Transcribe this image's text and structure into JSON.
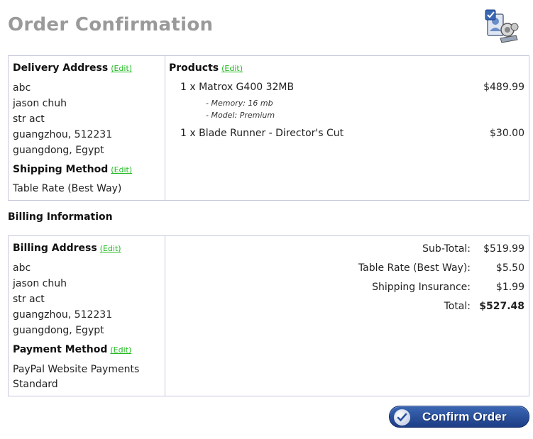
{
  "page": {
    "title": "Order Confirmation"
  },
  "edit_label": "(Edit)",
  "delivery": {
    "heading": "Delivery Address",
    "address": [
      "abc",
      "jason chuh",
      "str act",
      "guangzhou, 512231",
      "guangdong, Egypt"
    ],
    "shipping_heading": "Shipping Method",
    "shipping_method": "Table Rate (Best Way)"
  },
  "products": {
    "heading": "Products",
    "items": [
      {
        "name": "1 x Matrox G400 32MB",
        "price": "$489.99",
        "attributes": [
          "- Memory: 16 mb",
          "- Model: Premium"
        ]
      },
      {
        "name": "1 x Blade Runner - Director's Cut",
        "price": "$30.00",
        "attributes": []
      }
    ]
  },
  "billing": {
    "section_title": "Billing Information",
    "heading": "Billing Address",
    "address": [
      "abc",
      "jason chuh",
      "str act",
      "guangzhou, 512231",
      "guangdong, Egypt"
    ],
    "payment_heading": "Payment Method",
    "payment_method": [
      "PayPal Website Payments",
      "Standard"
    ]
  },
  "totals": [
    {
      "label": "Sub-Total:",
      "value": "$519.99",
      "bold": false
    },
    {
      "label": "Table Rate (Best Way):",
      "value": "$5.50",
      "bold": false
    },
    {
      "label": "Shipping Insurance:",
      "value": "$1.99",
      "bold": false
    },
    {
      "label": "Total:",
      "value": "$527.48",
      "bold": true
    }
  ],
  "confirm_button": {
    "label": "Confirm Order"
  },
  "icons": {
    "header": "user-card-icon",
    "confirm": "checkmark-icon"
  },
  "colors": {
    "title": "#9a9a9a",
    "border": "#c6c8dc",
    "edit_link": "#22bb22",
    "button": "#2a4f9e"
  }
}
